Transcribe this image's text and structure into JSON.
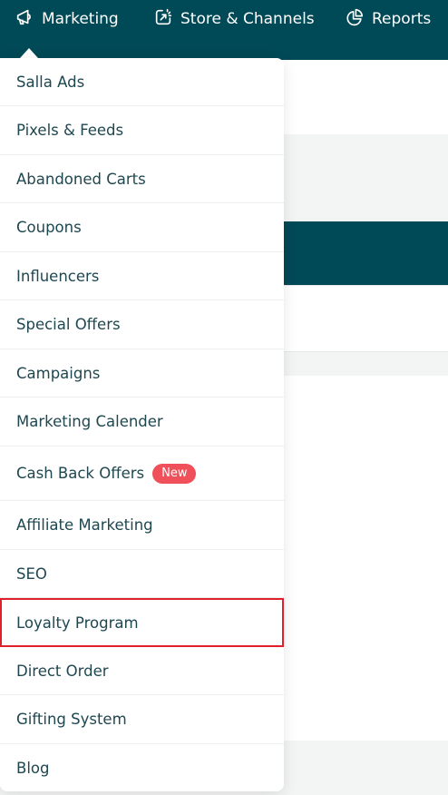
{
  "topnav": {
    "items": [
      {
        "label": "Marketing",
        "icon": "megaphone-icon"
      },
      {
        "label": "Store & Channels",
        "icon": "share-box-icon"
      },
      {
        "label": "Reports",
        "icon": "pie-chart-icon"
      }
    ]
  },
  "menu": {
    "items": [
      {
        "label": "Salla Ads"
      },
      {
        "label": "Pixels & Feeds"
      },
      {
        "label": "Abandoned Carts"
      },
      {
        "label": "Coupons"
      },
      {
        "label": "Influencers"
      },
      {
        "label": "Special Offers"
      },
      {
        "label": "Campaigns"
      },
      {
        "label": "Marketing Calender"
      },
      {
        "label": "Cash Back Offers",
        "badge": "New"
      },
      {
        "label": "Affiliate Marketing"
      },
      {
        "label": "SEO"
      },
      {
        "label": "Loyalty Program",
        "highlighted": true
      },
      {
        "label": "Direct Order"
      },
      {
        "label": "Gifting System"
      },
      {
        "label": "Blog"
      }
    ]
  },
  "colors": {
    "nav_bg": "#004956",
    "text": "#1e4750",
    "badge": "#f0505a",
    "highlight_border": "#e0202a"
  }
}
